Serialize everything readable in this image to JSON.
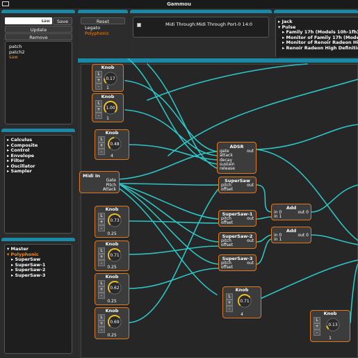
{
  "window": {
    "title": "Gammou"
  },
  "preset_panel": {
    "name_value": "saw",
    "save_label": "Save",
    "update_label": "Update",
    "remove_label": "Remove",
    "presets": [
      "patch",
      "patch2",
      "saw"
    ],
    "selected_preset": "saw"
  },
  "mode_panel": {
    "reset_label": "Reset",
    "modes": [
      "Legato",
      "Polyphonic"
    ],
    "selected_mode": "Polyphonic"
  },
  "midi_panel": {
    "device_label": "Midi Through:Midi Through Port-0 14:0"
  },
  "audio_tree": {
    "items": [
      "Jack",
      "Pulse",
      "Family 17h (Models 10h-1fh) HD Au",
      "Monitor of Family 17h (Models 10h-",
      "Monitor of Renoir Radeon High Defin",
      "Renoir Radeon High Definition Audi"
    ]
  },
  "plugin_tree": {
    "items": [
      "Calculus",
      "Composite",
      "Control",
      "Envelope",
      "Filter",
      "Oscillator",
      "Sampler"
    ]
  },
  "master_tree": {
    "items": [
      "Master",
      "Polyphonic",
      "SuperSaw",
      "SuperSaw-1",
      "SuperSaw-2",
      "SuperSaw-3"
    ],
    "selected": "Polyphonic"
  },
  "graph": {
    "knob_title": "Knob",
    "knob_L": "L",
    "knob_plus": "+",
    "knob_minus": "-",
    "knobs": [
      {
        "value": "0.17",
        "range": "1",
        "level": 0.17
      },
      {
        "value": "1.00",
        "range": "1",
        "level": 1.0
      },
      {
        "value": "0.48",
        "range": "4",
        "level": 0.48
      },
      {
        "value": "0.73",
        "range": "0.25",
        "level": 0.73
      },
      {
        "value": "0.71",
        "range": "0.25",
        "level": 0.71
      },
      {
        "value": "0.62",
        "range": "0.25",
        "level": 0.62
      },
      {
        "value": "0.69",
        "range": "0.25",
        "level": 0.69
      },
      {
        "value": "0.71",
        "range": "4",
        "level": 0.71
      },
      {
        "value": "0.13",
        "range": "1",
        "level": 0.13
      }
    ],
    "adsr": {
      "title": "ADSR",
      "inputs": [
        "gate",
        "attack",
        "decay",
        "sustain",
        "release"
      ],
      "output": "out"
    },
    "midi_in": {
      "title": "Midi In",
      "outputs": [
        "Gate",
        "Pitch",
        "Attack"
      ]
    },
    "supersaws": [
      {
        "title": "SuperSaw",
        "inputs": [
          "pitch",
          "offset"
        ],
        "output": "out"
      },
      {
        "title": "SuperSaw-1",
        "inputs": [
          "pitch",
          "offset"
        ],
        "output": "out"
      },
      {
        "title": "SuperSaw-2",
        "inputs": [
          "pitch",
          "offset"
        ],
        "output": "out"
      },
      {
        "title": "SuperSaw-3",
        "inputs": [
          "pitch",
          "offset"
        ],
        "output": "out"
      }
    ],
    "adds": [
      {
        "title": "Add",
        "inputs": [
          "in 0",
          "in 1"
        ],
        "output": "out 0"
      },
      {
        "title": "Add",
        "inputs": [
          "in 0",
          "in 1"
        ],
        "output": "out 0"
      }
    ],
    "wire_color": "#2ec4c4",
    "node_border_color": "#e07a1e",
    "accent_color": "#1989a6"
  }
}
